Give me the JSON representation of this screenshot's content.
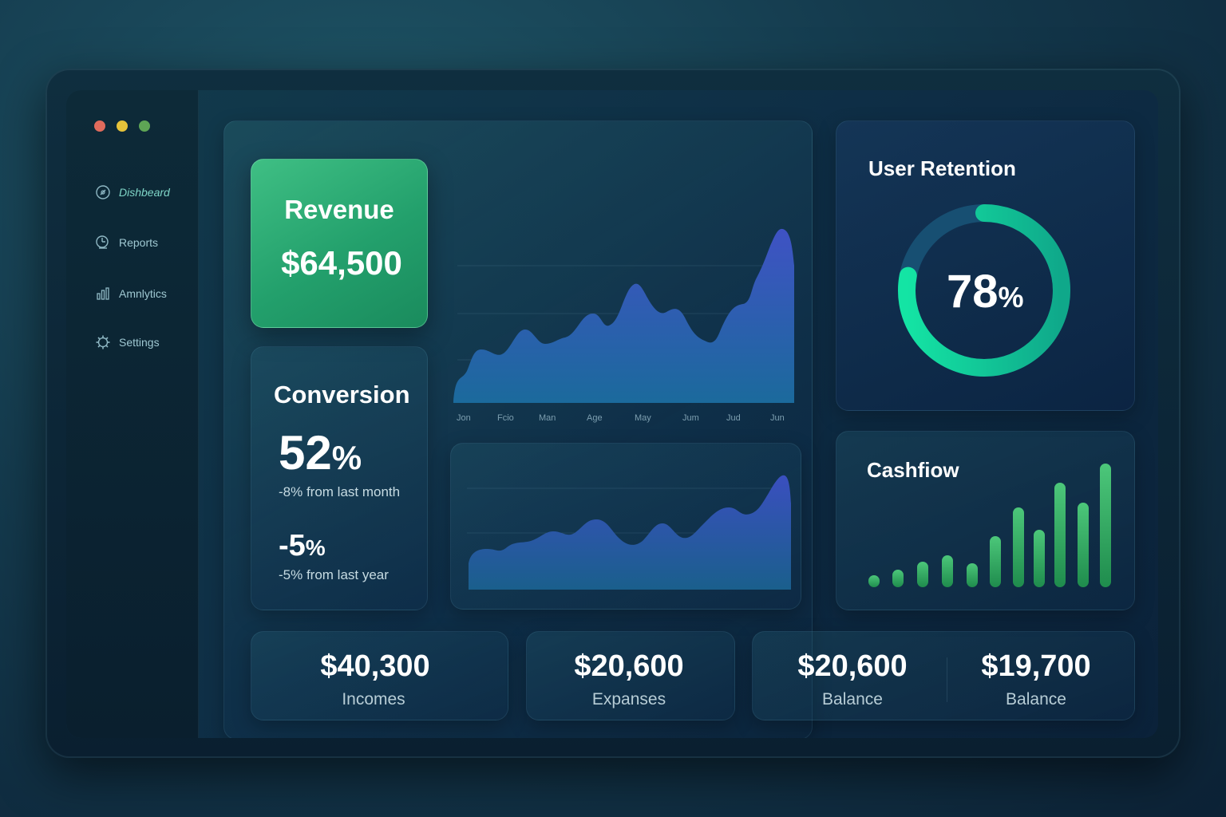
{
  "window": {
    "controls": {
      "close_color": "#e06b5c",
      "minimize_color": "#e6c33a",
      "maximize_color": "#5ea555"
    }
  },
  "sidebar": {
    "items": [
      {
        "label": "Dishbeard",
        "icon": "dashboard-icon",
        "active": true
      },
      {
        "label": "Reports",
        "icon": "reports-icon"
      },
      {
        "label": "Amnlytics",
        "icon": "analytics-icon"
      },
      {
        "label": "Settings",
        "icon": "gear-icon"
      }
    ]
  },
  "revenue": {
    "title": "Revenue",
    "value": "$64,500"
  },
  "conversion": {
    "title": "Conversion",
    "value_number": "52",
    "value_unit": "%",
    "sub1": "-8% from last month",
    "value2_number": "-5",
    "value2_unit": "%",
    "sub2": "-5% from last year"
  },
  "main_chart": {
    "months": [
      "Jon",
      "Fcio",
      "Man",
      "Age",
      "May",
      "Jum",
      "Jud",
      "Jun"
    ]
  },
  "retention": {
    "title": "User Retention",
    "value_number": "78",
    "value_unit": "%",
    "percent": 78
  },
  "cashflow": {
    "title": "Cashfiow"
  },
  "summary": [
    {
      "value": "$40,300",
      "label": "Incomes"
    },
    {
      "value": "$20,600",
      "label": "Expanses"
    },
    {
      "value": "$20,600",
      "label": "Balance"
    },
    {
      "value": "$19,700",
      "label": "Balance"
    }
  ],
  "colors": {
    "accent_green": "#2fb877",
    "ring_green": "#14e0a0",
    "chart_blue": "#3b55c8",
    "bar_green": "#3bb86a"
  }
}
